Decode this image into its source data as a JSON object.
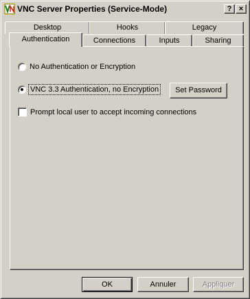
{
  "window": {
    "title": "VNC Server Properties (Service-Mode)",
    "help_label": "?",
    "close_label": "×"
  },
  "tabs": {
    "row_back": [
      {
        "label": "Desktop"
      },
      {
        "label": "Hooks"
      },
      {
        "label": "Legacy"
      }
    ],
    "row_front": [
      {
        "label": "Authentication",
        "active": true
      },
      {
        "label": "Connections"
      },
      {
        "label": "Inputs"
      },
      {
        "label": "Sharing"
      }
    ]
  },
  "authentication": {
    "option_none_label": "No Authentication or Encryption",
    "option_none_selected": false,
    "option_vnc_label": "VNC 3.3 Authentication, no Encryption",
    "option_vnc_selected": true,
    "set_password_label": "Set Password",
    "prompt_local_label": "Prompt local user to accept incoming connections",
    "prompt_local_checked": false
  },
  "footer": {
    "ok_label": "OK",
    "cancel_label": "Annuler",
    "apply_label": "Appliquer"
  },
  "colors": {
    "face": "#d4d0c8",
    "highlight": "#ffffff",
    "shadow": "#808080",
    "dark_shadow": "#404040"
  }
}
